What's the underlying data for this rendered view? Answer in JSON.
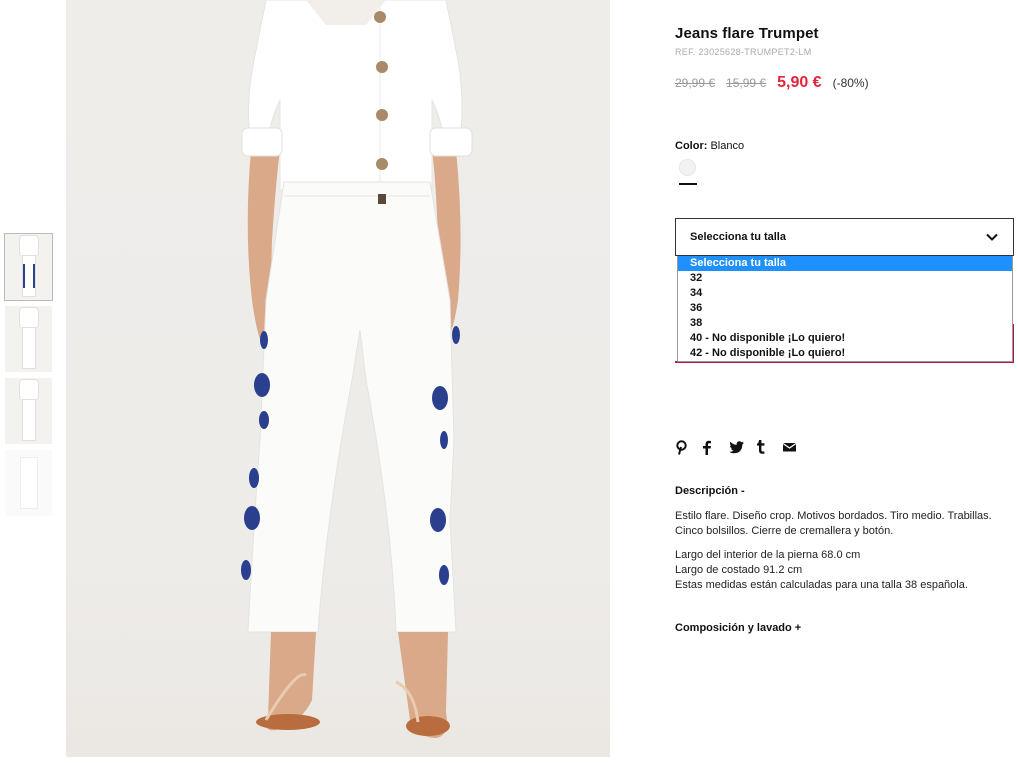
{
  "product": {
    "title": "Jeans flare Trumpet",
    "ref": "REF. 23025628-TRUMPET2-LM",
    "old_price_1": "29,99 €",
    "old_price_2": "15,99 €",
    "sale_price": "5,90 €",
    "discount": "(-80%)",
    "color_label": "Color:",
    "color_value": "Blanco"
  },
  "size": {
    "placeholder": "Selecciona tu talla",
    "options": [
      "Selecciona tu talla",
      "32",
      "34",
      "36",
      "38",
      "40 - No disponible ¡Lo quiero!",
      "42 - No disponible ¡Lo quiero!"
    ]
  },
  "social": [
    "pinterest-icon",
    "facebook-icon",
    "twitter-icon",
    "tumblr-icon",
    "mail-icon"
  ],
  "description": {
    "heading": "Descripción  -",
    "line1": "Estilo flare. Diseño crop. Motivos bordados. Tiro medio. Trabillas. Cinco bolsillos. Cierre de cremallera y botón.",
    "line2": "Largo del interior de la pierna 68.0 cm",
    "line3": "Largo de costado 91.2 cm",
    "line4": "Estas medidas están calculadas para una talla 38 española."
  },
  "composition": {
    "heading": "Composición y lavado  +"
  },
  "colors": {
    "accent_red": "#e2243c",
    "frame_red": "#b01943",
    "selected_option": "#1e90ff",
    "embroidery_blue": "#2b3f8f"
  }
}
